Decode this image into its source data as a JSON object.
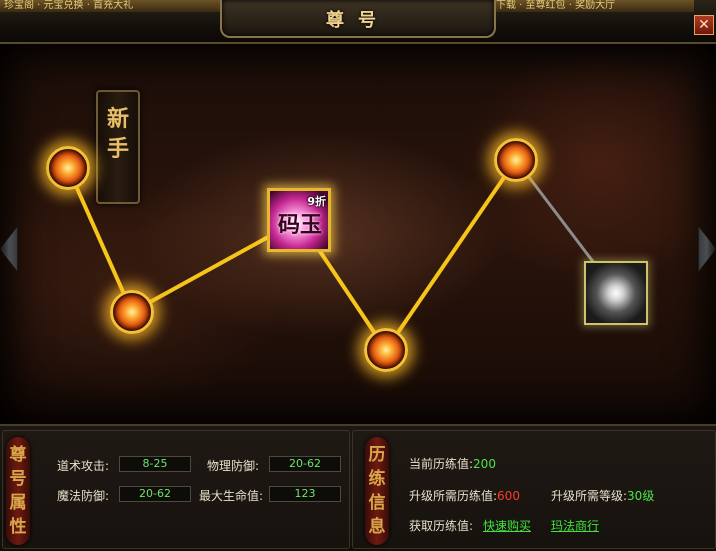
{
  "top_nav": {
    "left_tabs": "珍宝阁 · 元宝兑换 · 首充大礼",
    "right_tabs": "微端下载 · 至尊红包 · 奖励大厅"
  },
  "window": {
    "title": "尊号",
    "close_label": "✕"
  },
  "stage": {
    "rank_label": "新手",
    "current_rank_text": "码玉",
    "discount_label": "9折",
    "nodes_state": [
      "lit",
      "lit",
      "current",
      "lit",
      "lit",
      "locked"
    ]
  },
  "attributes": {
    "section_label": "尊号属性",
    "rows": [
      {
        "label": "道术攻击:",
        "value": "8-25",
        "label2": "物理防御:",
        "value2": "20-62"
      },
      {
        "label": "魔法防御:",
        "value": "20-62",
        "label2": "最大生命值:",
        "value2": "123"
      }
    ]
  },
  "experience": {
    "section_label": "历练信息",
    "current_label": "当前历练值:",
    "current_value": "200",
    "required_label": "升级所需历练值:",
    "required_value": "600",
    "level_req_label": "升级所需等级:",
    "level_req_value": "30级",
    "obtain_label": "获取历练值:",
    "quick_buy_link": "快速购买",
    "shop_link": "玛法商行"
  },
  "colors": {
    "accent_gold": "#f3c13a",
    "value_green": "#4ee34a",
    "warning_red": "#ff3a2a",
    "path_line": "#f5c518"
  },
  "icons": {
    "close": "close-icon",
    "prev": "chevron-left-icon",
    "next": "chevron-right-icon"
  }
}
